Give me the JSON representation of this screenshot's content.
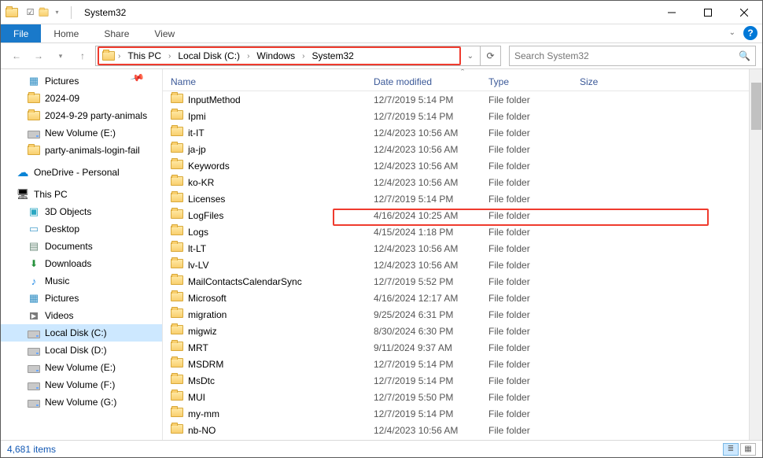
{
  "window": {
    "title": "System32"
  },
  "ribbon": {
    "tabs": [
      "File",
      "Home",
      "Share",
      "View"
    ]
  },
  "breadcrumb": [
    "This PC",
    "Local Disk (C:)",
    "Windows",
    "System32"
  ],
  "search_placeholder": "Search System32",
  "tree": {
    "pictures": "Pictures",
    "quick": [
      "2024-09",
      "2024-9-29 party-animals",
      "New Volume (E:)",
      "party-animals-login-fail"
    ],
    "onedrive": "OneDrive - Personal",
    "thispc": "This PC",
    "thispc_children": [
      "3D Objects",
      "Desktop",
      "Documents",
      "Downloads",
      "Music",
      "Pictures",
      "Videos",
      "Local Disk (C:)",
      "Local Disk (D:)",
      "New Volume (E:)",
      "New Volume (F:)",
      "New Volume (G:)"
    ]
  },
  "columns": {
    "name": "Name",
    "date": "Date modified",
    "type": "Type",
    "size": "Size"
  },
  "files": [
    {
      "name": "InputMethod",
      "date": "12/7/2019 5:14 PM",
      "type": "File folder"
    },
    {
      "name": "Ipmi",
      "date": "12/7/2019 5:14 PM",
      "type": "File folder"
    },
    {
      "name": "it-IT",
      "date": "12/4/2023 10:56 AM",
      "type": "File folder"
    },
    {
      "name": "ja-jp",
      "date": "12/4/2023 10:56 AM",
      "type": "File folder"
    },
    {
      "name": "Keywords",
      "date": "12/4/2023 10:56 AM",
      "type": "File folder"
    },
    {
      "name": "ko-KR",
      "date": "12/4/2023 10:56 AM",
      "type": "File folder"
    },
    {
      "name": "Licenses",
      "date": "12/7/2019 5:14 PM",
      "type": "File folder"
    },
    {
      "name": "LogFiles",
      "date": "4/16/2024 10:25 AM",
      "type": "File folder"
    },
    {
      "name": "Logs",
      "date": "4/15/2024 1:18 PM",
      "type": "File folder"
    },
    {
      "name": "lt-LT",
      "date": "12/4/2023 10:56 AM",
      "type": "File folder"
    },
    {
      "name": "lv-LV",
      "date": "12/4/2023 10:56 AM",
      "type": "File folder"
    },
    {
      "name": "MailContactsCalendarSync",
      "date": "12/7/2019 5:52 PM",
      "type": "File folder"
    },
    {
      "name": "Microsoft",
      "date": "4/16/2024 12:17 AM",
      "type": "File folder"
    },
    {
      "name": "migration",
      "date": "9/25/2024 6:31 PM",
      "type": "File folder"
    },
    {
      "name": "migwiz",
      "date": "8/30/2024 6:30 PM",
      "type": "File folder"
    },
    {
      "name": "MRT",
      "date": "9/11/2024 9:37 AM",
      "type": "File folder"
    },
    {
      "name": "MSDRM",
      "date": "12/7/2019 5:14 PM",
      "type": "File folder"
    },
    {
      "name": "MsDtc",
      "date": "12/7/2019 5:14 PM",
      "type": "File folder"
    },
    {
      "name": "MUI",
      "date": "12/7/2019 5:50 PM",
      "type": "File folder"
    },
    {
      "name": "my-mm",
      "date": "12/7/2019 5:14 PM",
      "type": "File folder"
    },
    {
      "name": "nb-NO",
      "date": "12/4/2023 10:56 AM",
      "type": "File folder"
    }
  ],
  "status": {
    "count": "4,681 items"
  }
}
